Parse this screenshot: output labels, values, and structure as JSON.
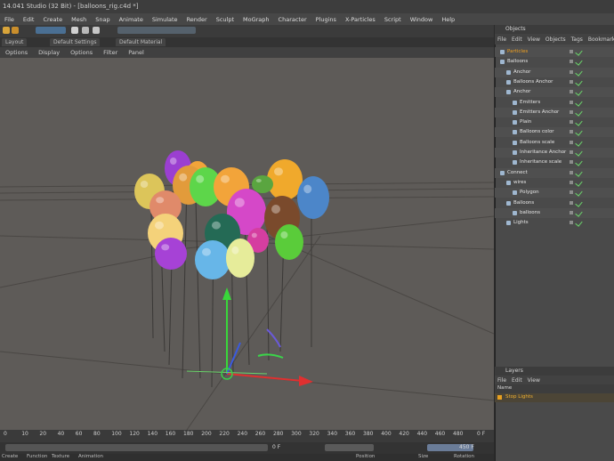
{
  "window": {
    "title": "14.041 Studio (32 Bit) - [balloons_rig.c4d *]"
  },
  "menubar": [
    "File",
    "Edit",
    "Create",
    "Mesh",
    "Snap",
    "Animate",
    "Simulate",
    "Render",
    "Sculpt",
    "MoGraph",
    "Character",
    "Plugins",
    "X-Particles",
    "Script",
    "Window",
    "Help"
  ],
  "layout_tabs": [
    "Layout",
    "Default Settings",
    "Default Material"
  ],
  "viewport_menu": [
    "Options",
    "Display",
    "Options",
    "Filter",
    "Panel"
  ],
  "timeline_ticks": [
    "0",
    "10",
    "20",
    "40",
    "60",
    "80",
    "100",
    "120",
    "140",
    "160",
    "180",
    "200",
    "220",
    "240",
    "260",
    "280",
    "300",
    "320",
    "340",
    "360",
    "380",
    "400",
    "420",
    "440",
    "460",
    "480"
  ],
  "timeline_end": "0 F",
  "transport": {
    "start_field": "0 F",
    "end_field": "450 F"
  },
  "bottom_bar": [
    "Create",
    "Function",
    "Texture",
    "Animation",
    "Position",
    "Size",
    "Rotation"
  ],
  "objects_panel": {
    "title": "Objects",
    "menu": [
      "File",
      "Edit",
      "View",
      "Objects",
      "Tags",
      "Bookmarks"
    ],
    "rows": [
      {
        "label": "Particles",
        "indent": 0,
        "highlight": true
      },
      {
        "label": "Balloons",
        "indent": 0
      },
      {
        "label": "Anchor",
        "indent": 1
      },
      {
        "label": "Balloons Anchor",
        "indent": 1
      },
      {
        "label": "Anchor",
        "indent": 1
      },
      {
        "label": "Emitters",
        "indent": 2
      },
      {
        "label": "Emitters Anchor",
        "indent": 2
      },
      {
        "label": "Plain",
        "indent": 2
      },
      {
        "label": "Balloons color",
        "indent": 2
      },
      {
        "label": "Balloons scale",
        "indent": 2
      },
      {
        "label": "Inheritance Anchor",
        "indent": 2
      },
      {
        "label": "Inheritance scale",
        "indent": 2
      },
      {
        "label": "Connect",
        "indent": 0
      },
      {
        "label": "wires",
        "indent": 1
      },
      {
        "label": "Polygon",
        "indent": 2
      },
      {
        "label": "Balloons",
        "indent": 1
      },
      {
        "label": "balloons",
        "indent": 2
      },
      {
        "label": "Lights",
        "indent": 1
      }
    ]
  },
  "layers_panel": {
    "title": "Layers",
    "menu": [
      "File",
      "Edit",
      "View"
    ],
    "column_header": "Name",
    "rows": [
      {
        "label": "Stop Lights",
        "color": "#e8a020"
      }
    ]
  },
  "balloons": [
    {
      "color": "#9b3fd1"
    },
    {
      "color": "#f2a43a"
    },
    {
      "color": "#e29b3b"
    },
    {
      "color": "#dcc55a"
    },
    {
      "color": "#5dd64a"
    },
    {
      "color": "#f2a43a"
    },
    {
      "color": "#f0a92c"
    },
    {
      "color": "#4c86c9"
    },
    {
      "color": "#e08a6a"
    },
    {
      "color": "#d548c8"
    },
    {
      "color": "#7a4a2c"
    },
    {
      "color": "#f4d27a"
    },
    {
      "color": "#246a55"
    },
    {
      "color": "#d53ea0"
    },
    {
      "color": "#a642d6"
    },
    {
      "color": "#67b6e8"
    },
    {
      "color": "#e6ec9a"
    },
    {
      "color": "#5acc3a"
    },
    {
      "color": "#5aa540"
    }
  ]
}
